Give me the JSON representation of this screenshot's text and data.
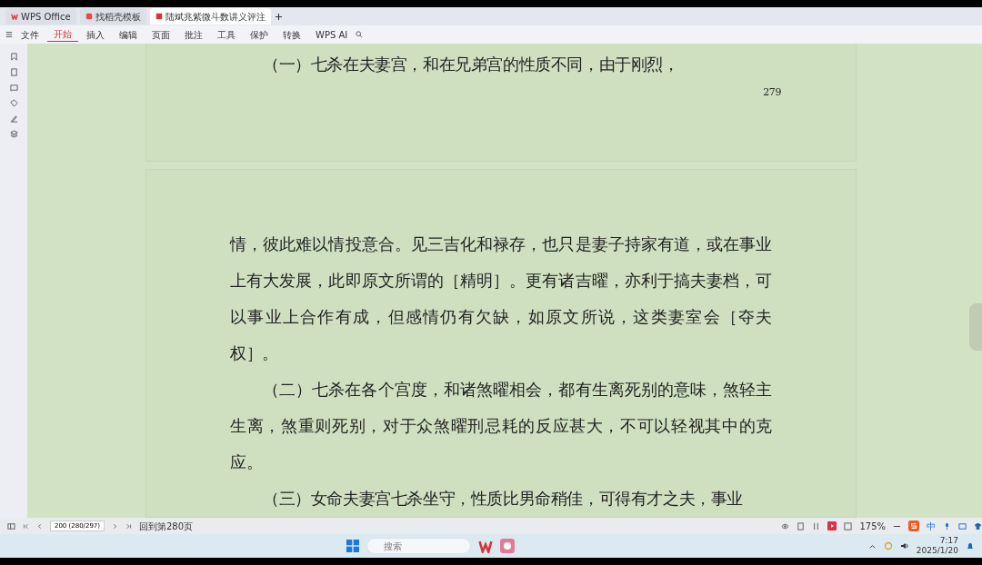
{
  "tabs": [
    {
      "label": "WPS Office",
      "kind": "home",
      "selected": false
    },
    {
      "label": "找稻壳模板",
      "kind": "template",
      "selected": false
    },
    {
      "label": "陆斌兆紫微斗数讲义评注",
      "kind": "pdf",
      "selected": true
    }
  ],
  "menu": [
    {
      "label": "文件",
      "selected": false
    },
    {
      "label": "开始",
      "selected": true
    },
    {
      "label": "插入",
      "selected": false
    },
    {
      "label": "编辑",
      "selected": false
    },
    {
      "label": "页面",
      "selected": false
    },
    {
      "label": "批注",
      "selected": false
    },
    {
      "label": "工具",
      "selected": false
    },
    {
      "label": "保护",
      "selected": false
    },
    {
      "label": "转换",
      "selected": false
    },
    {
      "label": "WPS AI",
      "selected": false
    }
  ],
  "pages": [
    {
      "paragraphs": [
        {
          "text": "（一）七杀在夫妻宫，和在兄弟宫的性质不同，由于刚烈，",
          "indent": true
        }
      ],
      "page_number": "279"
    },
    {
      "paragraphs": [
        {
          "text": "情，彼此难以情投意合。见三吉化和禄存，也只是妻子持家有道，或在事业上有大发展，此即原文所谓的［精明］。更有诸吉曜，亦利于搞夫妻档，可以事业上合作有成，但感情仍有欠缺，如原文所说，这类妻室会［夺夫权］。",
          "indent": false
        },
        {
          "text": "（二）七杀在各个宫度，和诸煞曜相会，都有生离死别的意味，煞轻主生离，煞重则死别，对于众煞曜刑忌耗的反应甚大，不可以轻视其中的克应。",
          "indent": true
        },
        {
          "text": "（三）女命夫妻宫七杀坐守，性质比男命稍佳，可得有才之夫，事业",
          "indent": true
        }
      ]
    }
  ],
  "status_bar": {
    "page_field": "200 (280/297)",
    "goto": "回到第280页",
    "zoom": "175%"
  },
  "taskbar": {
    "search_placeholder": "搜索",
    "ime": "中",
    "time": "7:17",
    "date": "2025/1/20"
  }
}
